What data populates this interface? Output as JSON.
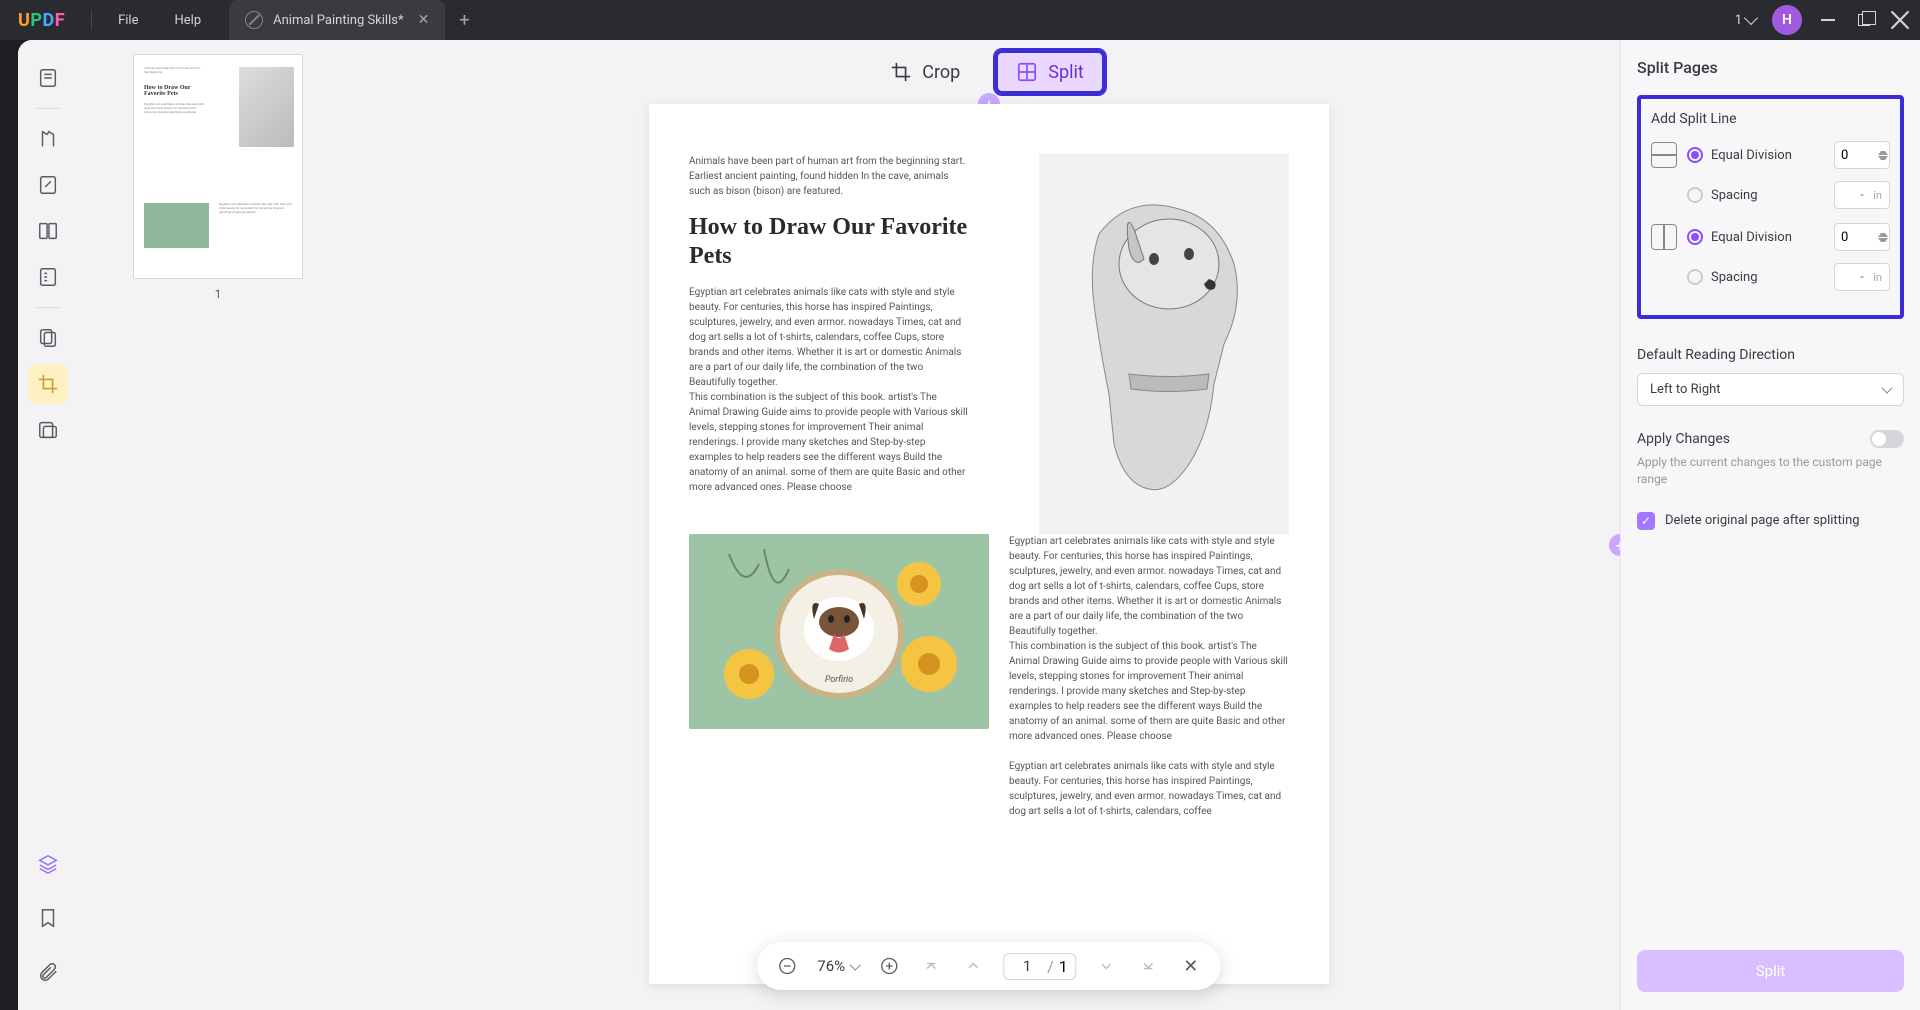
{
  "titlebar": {
    "menu_file": "File",
    "menu_help": "Help",
    "tab_title": "Animal Painting Skills*",
    "count": "1",
    "avatar_letter": "H"
  },
  "toolbar": {
    "crop": "Crop",
    "split": "Split"
  },
  "thumbnails": {
    "page1_num": "1"
  },
  "document": {
    "intro": "Animals have been part of human art from the beginning start. Earliest ancient painting, found hidden In the cave, animals such as bison (bison) are featured.",
    "title": "How to Draw Our Favorite Pets",
    "body1": "Egyptian art celebrates animals like cats with style and style beauty. For centuries, this horse has inspired Paintings, sculptures, jewelry, and even armor. nowadays Times, cat and dog art sells a lot of t-shirts, calendars, coffee Cups, store brands and other items. Whether it is art or domestic Animals are a part of our daily life, the combination of the two Beautifully together.\nThis combination is the subject of this book. artist's The Animal Drawing Guide aims to provide people with Various skill levels, stepping stones for improvement Their animal renderings. I provide many sketches and Step-by-step examples to help readers see the different ways Build the anatomy of an animal. some of them are quite Basic and other more advanced ones. Please choose",
    "body2": "Egyptian art celebrates animals like cats with style and style beauty. For centuries, this horse has inspired Paintings, sculptures, jewelry, and even armor. nowadays Times, cat and dog art sells a lot of t-shirts, calendars, coffee Cups, store brands and other items. Whether it is art or domestic Animals are a part of our daily life, the combination of the two Beautifully together.\nThis combination is the subject of this book. artist's The Animal Drawing Guide aims to provide people with Various skill levels, stepping stones for improvement Their animal renderings. I provide many sketches and Step-by-step examples to help readers see the different ways Build the anatomy of an animal. some of them are quite Basic and other more advanced ones. Please choose\n\nEgyptian art celebrates animals like cats with style and style beauty. For centuries, this horse has inspired Paintings, sculptures, jewelry, and even armor. nowadays Times, cat and dog art sells a lot of t-shirts, calendars, coffee"
  },
  "bottombar": {
    "zoom": "76%",
    "page_current": "1",
    "page_total": "1"
  },
  "panel": {
    "title": "Split Pages",
    "add_line": "Add Split Line",
    "equal_division": "Equal Division",
    "spacing": "Spacing",
    "value_h": "0",
    "value_v": "0",
    "spacing_ph": "-",
    "unit": "in",
    "dir_label": "Default Reading Direction",
    "dir_value": "Left to Right",
    "apply_label": "Apply Changes",
    "apply_desc": "Apply the current changes to the custom page range",
    "delete_label": "Delete original page after splitting",
    "split_btn": "Split"
  }
}
